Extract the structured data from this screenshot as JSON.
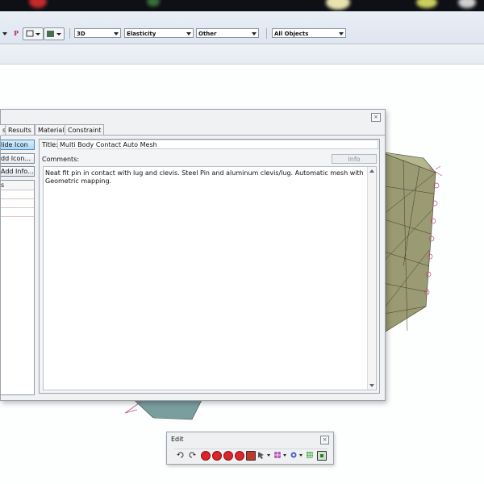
{
  "toolbar": {
    "dropdowns": [
      {
        "value": "3D"
      },
      {
        "value": "Elasticity"
      },
      {
        "value": "Other"
      },
      {
        "value": "All Objects"
      }
    ],
    "p_label": "P"
  },
  "dialog": {
    "close_glyph": "×",
    "tabs": [
      {
        "label": "s"
      },
      {
        "label": "Results"
      },
      {
        "label": "Material"
      },
      {
        "label": "Constraint"
      }
    ],
    "side_buttons": [
      {
        "label": "lide Icon",
        "active": true
      },
      {
        "label": "dd Icon...",
        "active": false
      },
      {
        "label": "Add Info...",
        "active": false
      }
    ],
    "list_header": "s",
    "title_label": "Title:",
    "title_value": "Multi Body Contact Auto Mesh",
    "comments_label": "Comments:",
    "info_label": "Info",
    "comments_text": "Neat fit pin in contact with lug and clevis. Steel Pin and aluminum clevis/lug. Automatic mesh with Geometric mapping."
  },
  "edit_window": {
    "title": "Edit",
    "close_glyph": "×",
    "tools": [
      "undo-icon",
      "redo-icon",
      "stop-icon",
      "stop-icon",
      "stop-icon",
      "stop-icon",
      "box-icon",
      "pointer-icon",
      "mesh-icon",
      "gear-icon",
      "grid-icon",
      "fit-icon"
    ]
  },
  "colors": {
    "mesh_fill": "#9a9a73",
    "mesh_dark": "#7c7c5a",
    "tab_active": "#a9d6f6",
    "stop_red": "#d9262c"
  }
}
